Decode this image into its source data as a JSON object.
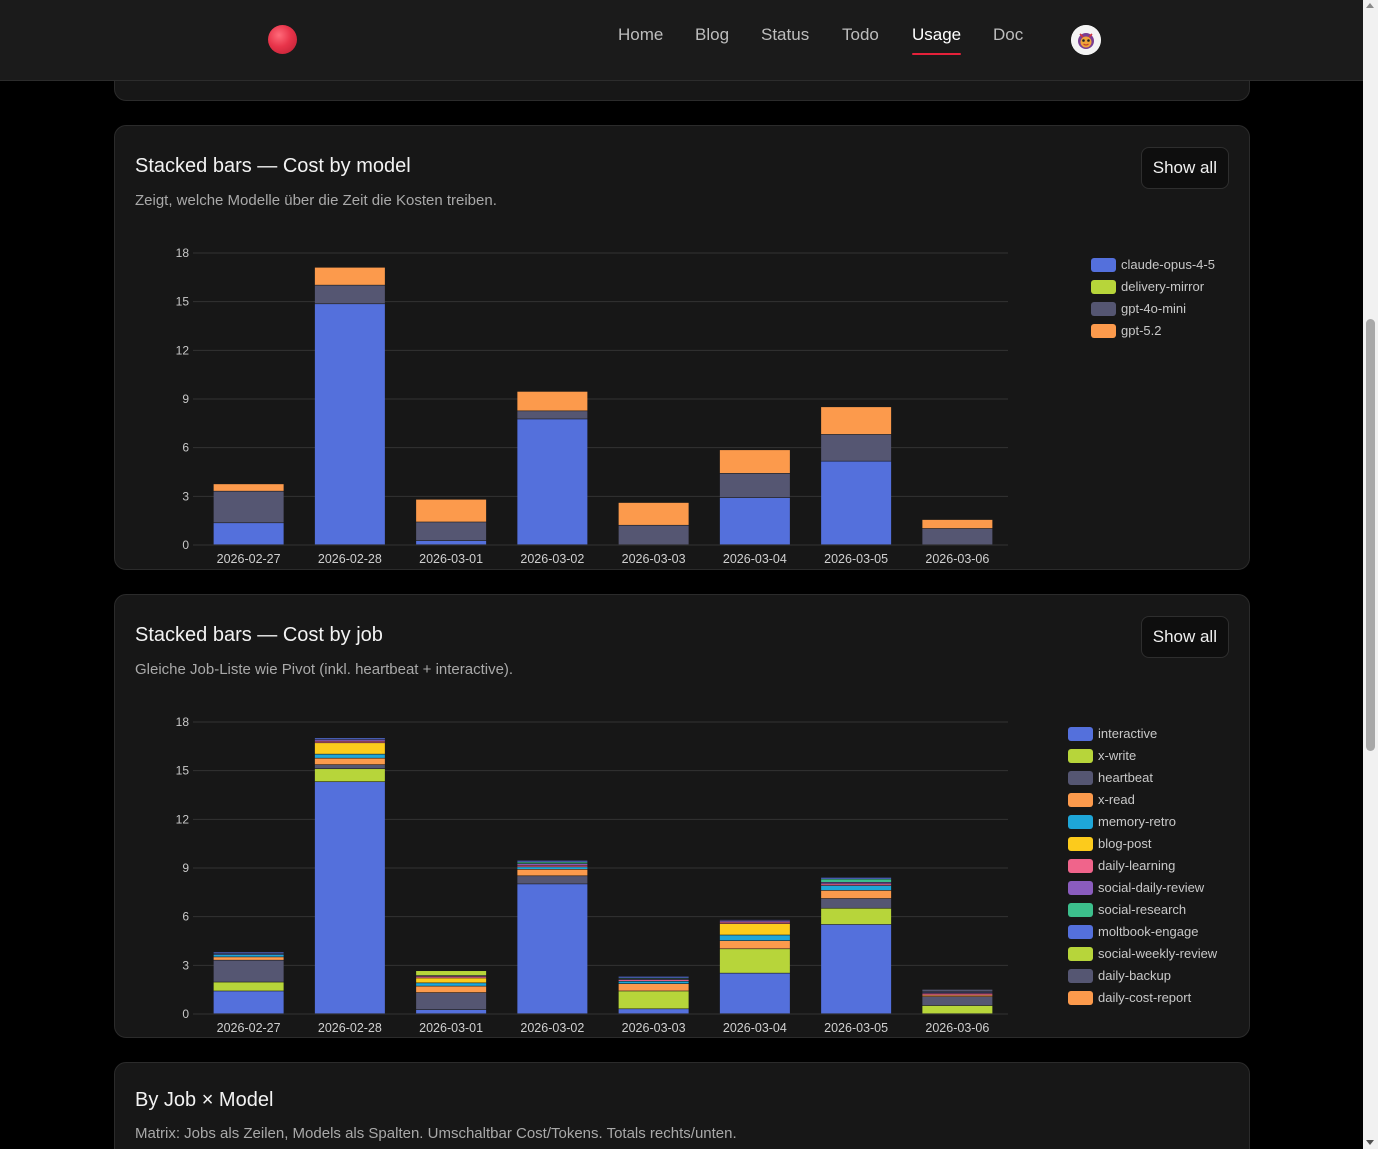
{
  "nav": {
    "items": [
      {
        "label": "Home",
        "active": false
      },
      {
        "label": "Blog",
        "active": false
      },
      {
        "label": "Status",
        "active": false
      },
      {
        "label": "Todo",
        "active": false
      },
      {
        "label": "Usage",
        "active": true
      },
      {
        "label": "Doc",
        "active": false
      }
    ],
    "accent_color": "#e5213a"
  },
  "cards": {
    "model": {
      "title": "Stacked bars — Cost by model",
      "subtitle": "Zeigt, welche Modelle über die Zeit die Kosten treiben.",
      "button": "Show all"
    },
    "job": {
      "title": "Stacked bars — Cost by job",
      "subtitle": "Gleiche Job-Liste wie Pivot (inkl. heartbeat + interactive).",
      "button": "Show all"
    },
    "matrix": {
      "title": "By Job × Model",
      "subtitle": "Matrix: Jobs als Zeilen, Models als Spalten. Umschaltbar Cost/Tokens. Totals rechts/unten."
    }
  },
  "chart_data": [
    {
      "type": "bar",
      "stacked": true,
      "title": "Stacked bars — Cost by model",
      "xlabel": "",
      "ylabel": "",
      "ylim": [
        0,
        18
      ],
      "yticks": [
        0,
        3,
        6,
        9,
        12,
        15,
        18
      ],
      "grid": true,
      "legend_position": "right",
      "categories": [
        "2026-02-27",
        "2026-02-28",
        "2026-03-01",
        "2026-03-02",
        "2026-03-03",
        "2026-03-04",
        "2026-03-05",
        "2026-03-06"
      ],
      "series": [
        {
          "name": "claude-opus-4-5",
          "color": "#5470dc",
          "values": [
            1.35,
            14.85,
            0.25,
            7.75,
            0.0,
            2.9,
            5.15,
            0.0
          ]
        },
        {
          "name": "delivery-mirror",
          "color": "#b7d53a",
          "values": [
            0,
            0,
            0,
            0,
            0,
            0,
            0,
            0
          ]
        },
        {
          "name": "gpt-4o-mini",
          "color": "#555672",
          "values": [
            1.95,
            1.15,
            1.15,
            0.5,
            1.2,
            1.5,
            1.65,
            1.0
          ]
        },
        {
          "name": "gpt-5.2",
          "color": "#fc9a4c",
          "values": [
            0.45,
            1.1,
            1.4,
            1.2,
            1.4,
            1.45,
            1.7,
            0.55
          ]
        }
      ]
    },
    {
      "type": "bar",
      "stacked": true,
      "title": "Stacked bars — Cost by job",
      "xlabel": "",
      "ylabel": "",
      "ylim": [
        0,
        18
      ],
      "yticks": [
        0,
        3,
        6,
        9,
        12,
        15,
        18
      ],
      "grid": true,
      "legend_position": "right",
      "categories": [
        "2026-02-27",
        "2026-02-28",
        "2026-03-01",
        "2026-03-02",
        "2026-03-03",
        "2026-03-04",
        "2026-03-05",
        "2026-03-06"
      ],
      "series": [
        {
          "name": "interactive",
          "color": "#5470dc",
          "values": [
            1.4,
            14.3,
            0.25,
            8.0,
            0.3,
            2.5,
            5.5,
            0.0
          ]
        },
        {
          "name": "x-write",
          "color": "#b7d53a",
          "values": [
            0.55,
            0.8,
            0.0,
            0.0,
            1.1,
            1.5,
            1.0,
            0.5
          ]
        },
        {
          "name": "heartbeat",
          "color": "#555672",
          "values": [
            1.35,
            0.25,
            1.05,
            0.5,
            0.0,
            0.0,
            0.6,
            0.55
          ]
        },
        {
          "name": "x-read",
          "color": "#fc9a4c",
          "values": [
            0.2,
            0.4,
            0.4,
            0.4,
            0.45,
            0.5,
            0.5,
            0.1
          ]
        },
        {
          "name": "memory-retro",
          "color": "#1ea6d8",
          "values": [
            0.15,
            0.25,
            0.2,
            0.15,
            0.15,
            0.35,
            0.3,
            0.0
          ]
        },
        {
          "name": "blog-post",
          "color": "#fccb1c",
          "values": [
            0.0,
            0.7,
            0.3,
            0.0,
            0.0,
            0.7,
            0.0,
            0.0
          ]
        },
        {
          "name": "daily-learning",
          "color": "#f0648b",
          "values": [
            0.0,
            0.1,
            0.1,
            0.1,
            0.1,
            0.1,
            0.1,
            0.1
          ]
        },
        {
          "name": "social-daily-review",
          "color": "#8a5cbe",
          "values": [
            0.05,
            0.1,
            0.0,
            0.1,
            0.05,
            0.1,
            0.1,
            0.05
          ]
        },
        {
          "name": "social-research",
          "color": "#3cbf8c",
          "values": [
            0.0,
            0.0,
            0.0,
            0.1,
            0.05,
            0.0,
            0.2,
            0.0
          ]
        },
        {
          "name": "moltbook-engage",
          "color": "#5470dc",
          "values": [
            0.1,
            0.1,
            0.05,
            0.1,
            0.1,
            0.05,
            0.1,
            0.05
          ]
        },
        {
          "name": "social-weekly-review",
          "color": "#b7d53a",
          "values": [
            0.0,
            0.0,
            0.3,
            0.0,
            0.0,
            0.0,
            0.0,
            0.0
          ]
        },
        {
          "name": "daily-backup",
          "color": "#555672",
          "values": [
            0.0,
            0.0,
            0.0,
            0.0,
            0.0,
            0.0,
            0.0,
            0.15
          ]
        },
        {
          "name": "daily-cost-report",
          "color": "#fc9a4c",
          "values": [
            0.0,
            0.0,
            0.0,
            0.0,
            0.0,
            0.0,
            0.0,
            0.0
          ]
        }
      ]
    }
  ]
}
